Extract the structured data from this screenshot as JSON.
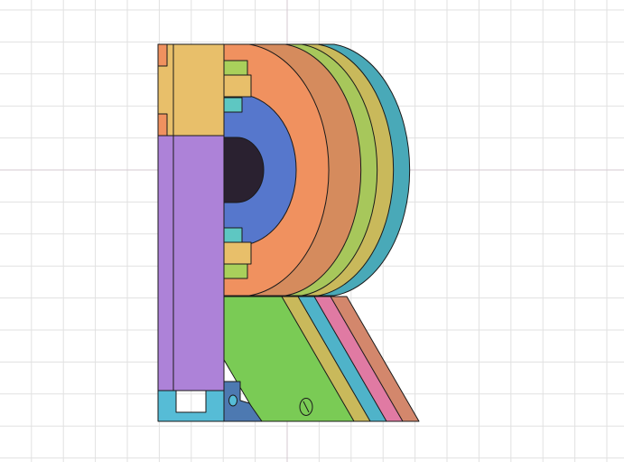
{
  "viewport": {
    "background": "#ffffff",
    "grid_color": "#e1e1e1",
    "axis_color": "#d6c9d2",
    "edge_color": "#1a1a1a"
  },
  "model": {
    "stem_color": "#ad82d8",
    "top_block_color": "#e8bf6a",
    "base_block_color": "#56bcd6",
    "inner_ring_color": "#5677cc",
    "hole_color": "#2a2130",
    "bowl_colors": [
      "#f0915f",
      "#d58b5d",
      "#a7c75b",
      "#c9b95b",
      "#49a9b8"
    ],
    "leg_colors": [
      "#7acb55",
      "#c9b95b",
      "#4fb3c9",
      "#e07aa3",
      "#d3876c"
    ],
    "tab_colors": [
      "#e8bf6a",
      "#a9d05b",
      "#5ec7c2"
    ],
    "bracket_color": "#4d79b1"
  }
}
